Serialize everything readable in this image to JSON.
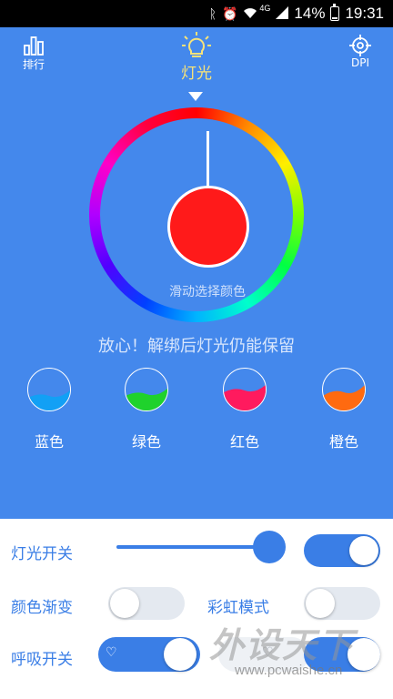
{
  "status": {
    "battery_percent": "14%",
    "time": "19:31",
    "network": "4G",
    "icons": [
      "bluetooth-icon",
      "alarm-icon",
      "wifi-icon",
      "signal-icon",
      "battery-icon"
    ]
  },
  "header": {
    "left_label": "排行",
    "center_label": "灯光",
    "right_label": "DPI"
  },
  "wheel": {
    "hint": "滑动选择颜色",
    "selected_color": "#ff1a1a"
  },
  "notice": "放心！解绑后灯光仍能保留",
  "presets": [
    {
      "label": "蓝色",
      "color": "#12a0f5"
    },
    {
      "label": "绿色",
      "color": "#1fd22c"
    },
    {
      "label": "红色",
      "color": "#ff1a5e"
    },
    {
      "label": "橙色",
      "color": "#ff6a10"
    }
  ],
  "controls": {
    "light_switch_label": "灯光开关",
    "brightness_value": 1.0,
    "light_switch_on": true,
    "color_fade_label": "颜色渐变",
    "color_fade_on": false,
    "rainbow_label": "彩虹模式",
    "rainbow_on": false,
    "breathing_label": "呼吸开关",
    "breathing_on": true
  },
  "watermark": {
    "text": "外设天下",
    "url": "www.pcwaishe.cn"
  },
  "colors": {
    "primary_blue": "#4488ec",
    "accent_blue": "#3a7ee6",
    "light_label": "#f6e27a"
  }
}
